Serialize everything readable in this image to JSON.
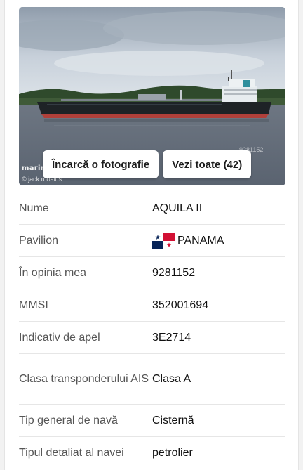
{
  "photo": {
    "upload_label": "Încarcă o fotografie",
    "view_all_label": "Vezi toate (42)",
    "watermark": "marine",
    "credit": "© jack ronalds",
    "imo_mark": "9281152"
  },
  "details": [
    {
      "label": "Nume",
      "value": "AQUILA II"
    },
    {
      "label": "Pavilion",
      "value": "PANAMA",
      "flag": "panama-flag-icon"
    },
    {
      "label": "În opinia mea",
      "value": "9281152"
    },
    {
      "label": "MMSI",
      "value": "352001694"
    },
    {
      "label": "Indicativ de apel",
      "value": "3E2714"
    },
    {
      "label": "Clasa transponderului AIS",
      "value": "Clasa A"
    },
    {
      "label": "Tip general de navă",
      "value": "Cisternă"
    },
    {
      "label": "Tipul detaliat al navei",
      "value": "petrolier"
    }
  ],
  "colors": {
    "panama_red": "#d21034",
    "panama_blue": "#072357",
    "hull_red": "#b0403a",
    "hull_dark": "#1e2326"
  }
}
